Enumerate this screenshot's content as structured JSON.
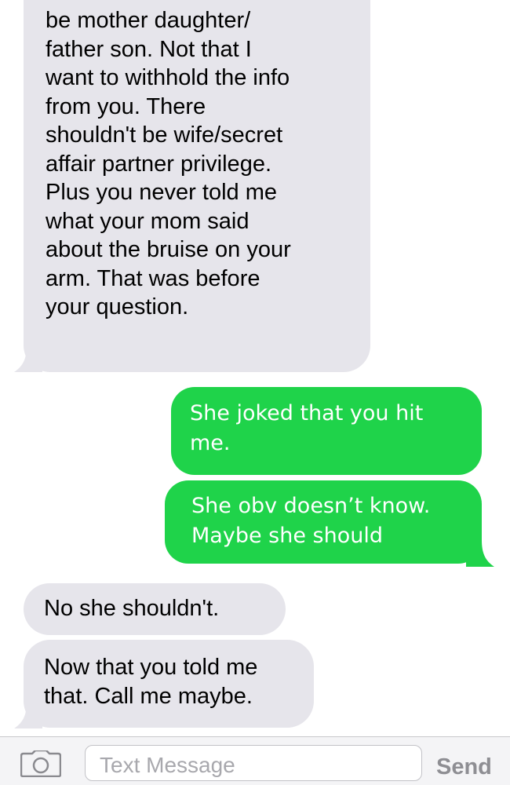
{
  "messages": [
    {
      "direction": "received",
      "text": "be mother daughter/\nfather son. Not that I\nwant to withhold the info\nfrom you. There\nshouldn't be wife/secret\naffair partner privilege.\nPlus you never told me\nwhat your mom said\nabout the bruise on your\narm. That was before\nyour question."
    },
    {
      "direction": "sent",
      "text": "She joked that you hit\nme."
    },
    {
      "direction": "sent",
      "text": "She obv doesn’t know.\nMaybe she should"
    },
    {
      "direction": "received",
      "text": "No she shouldn't."
    },
    {
      "direction": "received",
      "text": "Now that you told me\nthat. Call me maybe."
    }
  ],
  "input_bar": {
    "camera_icon": "camera-icon",
    "placeholder": "Text Message",
    "send_label": "Send"
  },
  "colors": {
    "received_bubble": "#e6e5eb",
    "sent_bubble": "#1fd34a",
    "send_disabled": "#8e8e93"
  }
}
